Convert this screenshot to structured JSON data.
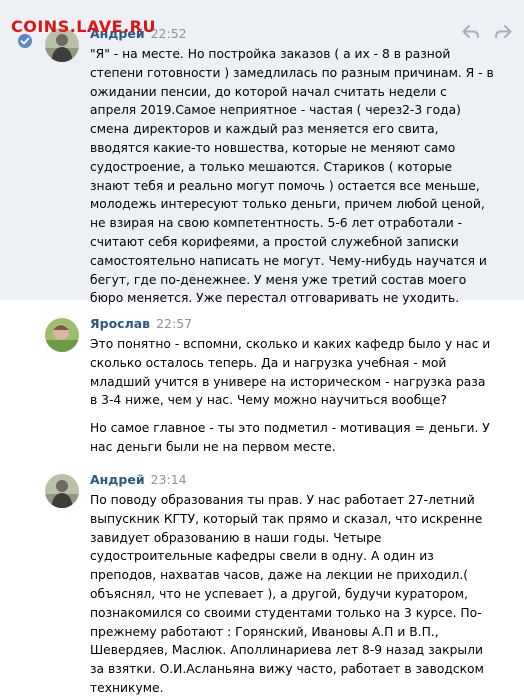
{
  "watermark": "COINS.LAVE.RU",
  "messages": [
    {
      "author": "Андрей",
      "time": "22:52",
      "paragraphs": [
        "\"Я\" - на месте. Но постройка заказов ( а их - 8 в разной степени готовности ) замедлилась по разным причинам. Я - в ожидании пенсии, до которой начал считать недели с апреля 2019.Самое неприятное - частая ( через2-3 года) смена директоров и каждый раз меняется его свита, вводятся какие-то новшества, которые не меняют само судостроение, а только мешаются. Стариков ( которые знают тебя и реально могут помочь ) остается все меньше, молодежь интересуют только деньги, причем любой ценой, не взирая на свою компетентность. 5-6 лет отработали - считают себя корифеями, а простой служебной записки самостоятельно написать не могут. Чему-нибудь научатся и бегут, где по-денежнее. У меня уже третий состав моего бюро меняется. Уже перестал отговаривать не уходить."
      ]
    },
    {
      "author": "Ярослав",
      "time": "22:57",
      "paragraphs": [
        "Это понятно - вспомни, сколько и каких кафедр было у нас и сколько осталось теперь. Да и нагрузка учебная - мой младший учится в универе на историческом - нагрузка раза в 3-4 ниже, чем у нас. Чему можно научиться вообще?",
        "Но самое главное - ты это подметил - мотивация = деньги. У нас деньги были не на первом месте."
      ]
    },
    {
      "author": "Андрей",
      "time": "23:14",
      "paragraphs": [
        "По поводу образования ты прав. У нас работает 27-летний выпускник КГТУ, который так прямо и сказал, что искренне завидует образованию в наши годы. Четыре судостроительные кафедры свели в одну. А один из преподов, нахватав часов, даже на лекции не приходил.( объяснял, что не успевает ), а другой, будучи куратором, познакомился со своими студентами только на 3 курсе. По-прежнему работают : Горянский, Ивановы А.П и В.П., Шевердяев, Маслюк. Аполлинариева лет 8-9 назад закрыли за взятки. О.И.Асланьяна вижу часто, работает в заводском техникуме."
      ]
    }
  ],
  "icons": {
    "selected": "check-icon",
    "reply": "reply-icon",
    "forward": "forward-icon"
  },
  "colors": {
    "author": "#2a5885",
    "time": "#939393",
    "selected_bg": "#edf1f6",
    "check": "#5c88c5",
    "watermark": "#e11414"
  }
}
